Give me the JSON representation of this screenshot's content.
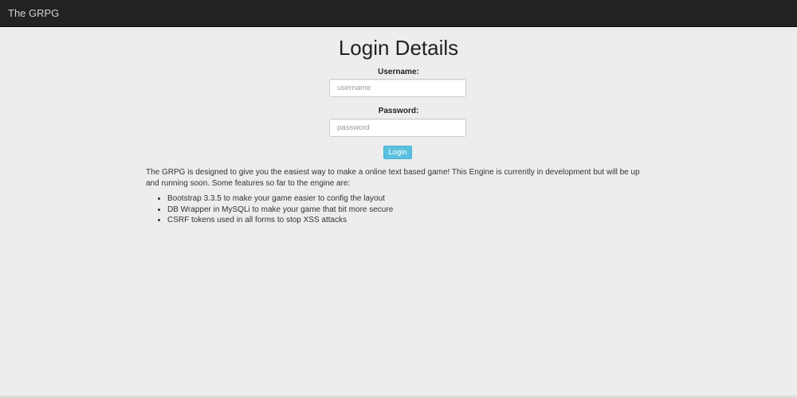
{
  "navbar": {
    "brand": "The GRPG"
  },
  "login": {
    "title": "Login Details",
    "username_label": "Username:",
    "username_placeholder": "username",
    "username_value": "",
    "password_label": "Password:",
    "password_placeholder": "password",
    "password_value": "",
    "submit_label": "Login"
  },
  "content": {
    "intro": "The GRPG is designed to give you the easiest way to make a online text based game! This Engine is currently in development but will be up and running soon. Some features so far to the engine are:",
    "features": [
      "Bootstrap 3.3.5 to make your game easier to config the layout",
      "DB Wrapper in MySQLi to make your game that bit more secure",
      "CSRF tokens used in all forms to stop XSS attacks"
    ]
  },
  "colors": {
    "navbar_bg": "#222222",
    "page_bg": "#ededed",
    "button_bg": "#5bc0de"
  }
}
